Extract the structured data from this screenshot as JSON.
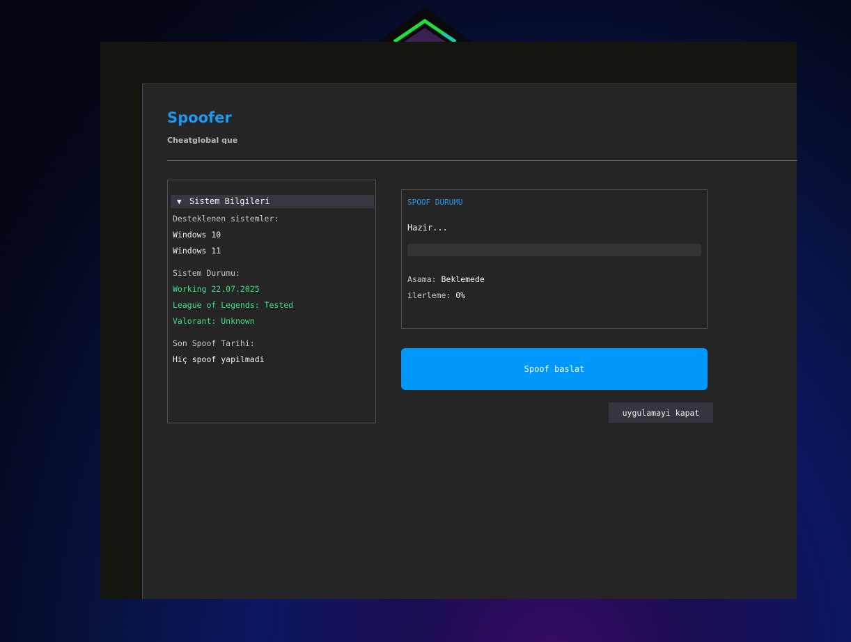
{
  "app": {
    "title": "Spoofer",
    "subtitle": "Cheatglobal que"
  },
  "system_panel": {
    "header": "Sistem Bilgileri",
    "arrow": "▼",
    "supported_label": "Desteklenen sistemler:",
    "supported": [
      "Windows 10",
      "Windows 11"
    ],
    "status_label": "Sistem Durumu:",
    "status_lines": [
      "Working 22.07.2025",
      "League of Legends: Tested",
      "Valorant: Unknown"
    ],
    "last_spoof_label": "Son Spoof Tarihi:",
    "last_spoof_value": "Hiç spoof yapilmadi"
  },
  "status_panel": {
    "title": "SPOOF DURUMU",
    "state_text": "Hazir...",
    "progress": 0,
    "stage_label": "Asama:",
    "stage_value": "Beklemede",
    "progress_label": "ilerleme:",
    "progress_value": "0%"
  },
  "buttons": {
    "spoof_label": "Spoof baslat",
    "close_label": "uygulamayi kapat"
  },
  "colors": {
    "accent": "#1e98f0",
    "button": "#0098fb",
    "success": "#3de08a"
  }
}
